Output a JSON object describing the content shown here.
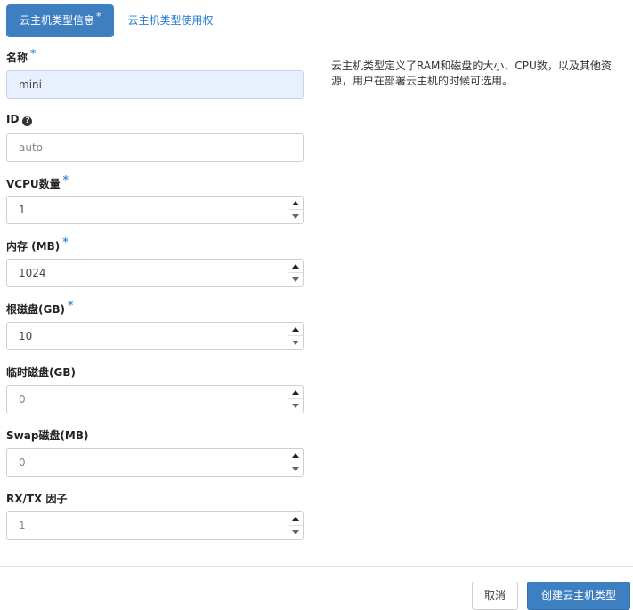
{
  "tabs": [
    {
      "label": "云主机类型信息",
      "required_mark": "*"
    },
    {
      "label": "云主机类型使用权"
    }
  ],
  "form": {
    "name": {
      "label": "名称",
      "required_mark": "*",
      "value": "mini"
    },
    "id": {
      "label": "ID",
      "help_icon": "question-circle-icon",
      "help_glyph": "?",
      "value": "auto"
    },
    "vcpu": {
      "label": "VCPU数量",
      "required_mark": "*",
      "value": "1"
    },
    "ram": {
      "label": "内存 (MB)",
      "required_mark": "*",
      "value": "1024"
    },
    "root_disk": {
      "label": "根磁盘(GB)",
      "required_mark": "*",
      "value": "10"
    },
    "ephemeral_disk": {
      "label": "临时磁盘(GB)",
      "value": "0"
    },
    "swap_disk": {
      "label": "Swap磁盘(MB)",
      "value": "0"
    },
    "rxtx_factor": {
      "label": "RX/TX 因子",
      "value": "1"
    }
  },
  "description": "云主机类型定义了RAM和磁盘的大小、CPU数，以及其他资源，用户在部署云主机的时候可选用。",
  "footer": {
    "cancel_label": "取消",
    "submit_label": "创建云主机类型"
  },
  "colors": {
    "primary": "#3d7fc1",
    "link": "#2a7fd4",
    "required_mark": "#3d8fd4",
    "filled_input_bg": "#e8f0fd"
  }
}
